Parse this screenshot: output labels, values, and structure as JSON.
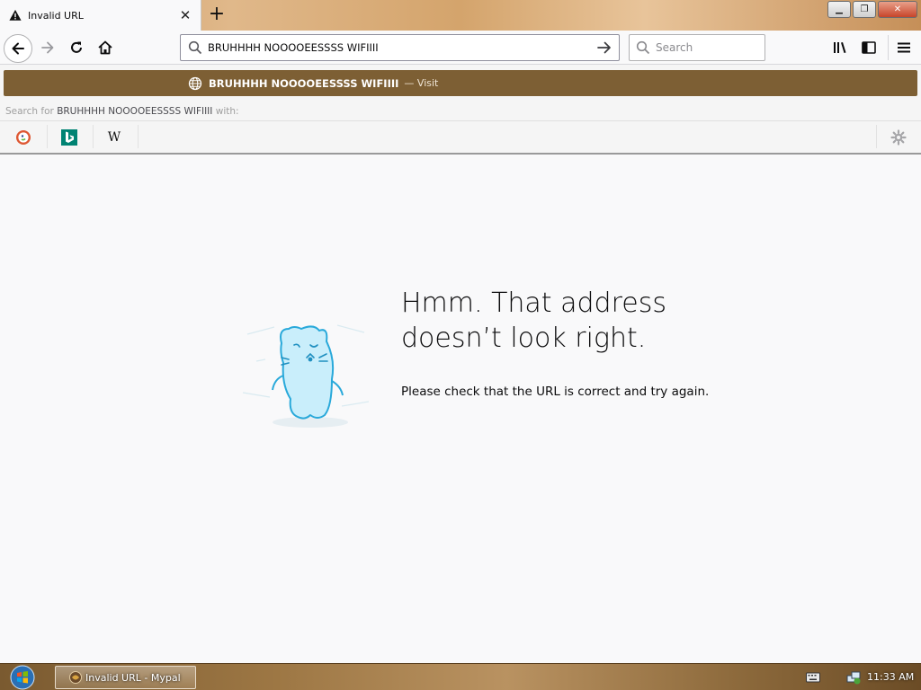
{
  "tab": {
    "title": "Invalid URL",
    "close_label": "✕"
  },
  "new_tab_label": "+",
  "window_buttons": {
    "minimize": "▁",
    "maximize": "❐",
    "close": "✕"
  },
  "urlbar": {
    "value": "BRUHHHH NOOOOEESSSS WIFIIII"
  },
  "searchbar": {
    "placeholder": "Search"
  },
  "popup": {
    "suggestion_text": "BRUHHHH NOOOOEESSSS WIFIIII",
    "suggestion_action": "— Visit",
    "search_for_prefix": "Search for ",
    "search_for_term": "BRUHHHH NOOOOEESSSS WIFIIII",
    "search_for_suffix": " with:",
    "engines": [
      "duckduckgo-icon",
      "bing-icon",
      "wikipedia-icon"
    ],
    "wikipedia_glyph": "W"
  },
  "error": {
    "title": "Hmm. That address doesn’t look right.",
    "description": "Please check that the URL is correct and try again."
  },
  "taskbar": {
    "task_label": "Invalid URL - Mypal",
    "clock": "11:33 AM"
  },
  "colors": {
    "suggestion_bg": "#7d5f34",
    "mascot_blue": "#4fc3e8",
    "error_text": "#0c0c0d"
  }
}
